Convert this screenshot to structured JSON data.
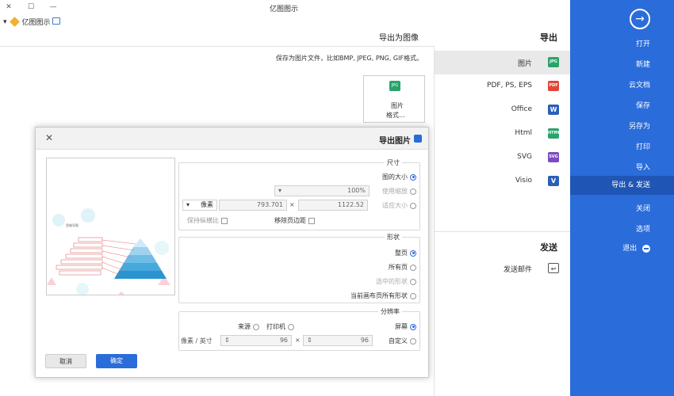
{
  "window": {
    "title": "亿图图示",
    "minimize": "—",
    "maximize": "☐",
    "close": "✕"
  },
  "qat": {
    "app_label": "亿图图示"
  },
  "sidebar": {
    "items": [
      {
        "label": "打开"
      },
      {
        "label": "新建"
      },
      {
        "label": "云文档"
      },
      {
        "label": "保存"
      },
      {
        "label": "另存为"
      },
      {
        "label": "打印"
      },
      {
        "label": "导入"
      },
      {
        "label": "导出 & 发送"
      },
      {
        "label": "关闭"
      },
      {
        "label": "选项"
      },
      {
        "label": "退出"
      }
    ]
  },
  "middle": {
    "export_heading": "导出",
    "send_heading": "发送",
    "items": [
      {
        "label": "图片",
        "icon": "JPG",
        "color": "#2aa36b"
      },
      {
        "label": "PDF, PS, EPS",
        "icon": "PDF",
        "color": "#e0463a"
      },
      {
        "label": "Office",
        "icon": "W",
        "color": "#2b5fb8"
      },
      {
        "label": "Html",
        "icon": "HTML",
        "color": "#2aa36b"
      },
      {
        "label": "SVG",
        "icon": "SVG",
        "color": "#7c4bc2"
      },
      {
        "label": "Visio",
        "icon": "V",
        "color": "#2b5fb8"
      }
    ],
    "send_item": "发送邮件"
  },
  "main": {
    "title": "导出为图像",
    "description": "保存为图片文件，比如BMP, JPEG, PNG, GIF格式。",
    "card_line1": "图片",
    "card_line2": "格式..."
  },
  "dialog": {
    "title": "导出图片",
    "size_group": "尺寸",
    "size_options": {
      "original": "图的大小",
      "scale": "使用缩放",
      "fit": "适应大小"
    },
    "scale_value": "100%",
    "width_value": "1122.52",
    "height_value": "793.701",
    "unit": "像素",
    "remove_margin": "移除页边距",
    "keep_ratio": "保持纵横比",
    "shape_group": "形状",
    "shape_options": {
      "whole_page": "整页",
      "all_pages": "所有页",
      "selected": "选中的形状",
      "current_all": "当前画布页所有形状"
    },
    "resolution_group": "分辨率",
    "res_options": {
      "screen": "屏幕",
      "printer": "打印机",
      "source": "来源",
      "custom": "自定义"
    },
    "res_x": "96",
    "res_y": "96",
    "res_unit": "像素 / 英寸",
    "ok_button": "确定",
    "cancel_button": "取消"
  },
  "preview_diagram": {
    "title": "思维导图",
    "pyramid_colors": [
      "#cfe9f7",
      "#9ed3ef",
      "#6fbde6",
      "#45a9dd",
      "#2a94d0"
    ]
  }
}
